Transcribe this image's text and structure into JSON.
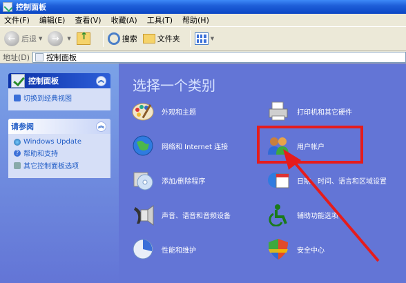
{
  "window": {
    "title": "控制面板"
  },
  "menu": [
    "文件(F)",
    "编辑(E)",
    "查看(V)",
    "收藏(A)",
    "工具(T)",
    "帮助(H)"
  ],
  "toolbar": {
    "back": "后退",
    "search": "搜索",
    "folders": "文件夹"
  },
  "address": {
    "label": "地址(D)",
    "value": "控制面板"
  },
  "sidebar": {
    "panel1": {
      "title": "控制面板",
      "link": "切换到经典视图"
    },
    "panel2": {
      "title": "请参阅",
      "links": [
        "Windows Update",
        "帮助和支持",
        "其它控制面板选项"
      ]
    }
  },
  "main": {
    "title": "选择一个类别",
    "categories": [
      {
        "label": "外观和主题",
        "icon": "appearance-icon"
      },
      {
        "label": "打印机和其它硬件",
        "icon": "printer-icon"
      },
      {
        "label": "网络和 Internet 连接",
        "icon": "network-globe-icon"
      },
      {
        "label": "用户帐户",
        "icon": "user-accounts-icon"
      },
      {
        "label": "添加/删除程序",
        "icon": "add-remove-programs-icon"
      },
      {
        "label": "日期、时间、语言和区域设置",
        "icon": "date-time-icon"
      },
      {
        "label": "声音、语音和音频设备",
        "icon": "speaker-icon"
      },
      {
        "label": "辅助功能选项",
        "icon": "accessibility-icon"
      },
      {
        "label": "性能和维护",
        "icon": "performance-icon"
      },
      {
        "label": "安全中心",
        "icon": "security-shield-icon"
      }
    ]
  },
  "colors": {
    "highlight": "#e51c1c",
    "title_bar": "#0a46c4",
    "content_bg": "#6375d6"
  }
}
